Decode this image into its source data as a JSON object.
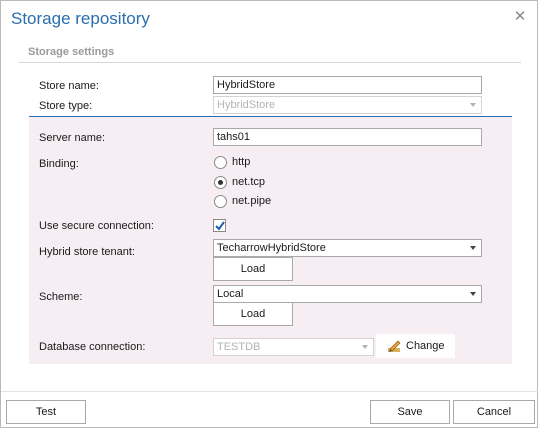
{
  "dialog": {
    "title": "Storage repository",
    "close_glyph": "✕"
  },
  "section": {
    "title": "Storage settings"
  },
  "fields": {
    "store_name_label": "Store name:",
    "store_name_value": "HybridStore",
    "store_type_label": "Store type:",
    "store_type_value": "HybridStore",
    "server_name_label": "Server name:",
    "server_name_value": "tahs01",
    "binding_label": "Binding:",
    "binding_options": [
      "http",
      "net.tcp",
      "net.pipe"
    ],
    "binding_selected": "net.tcp",
    "secure_label": "Use secure connection:",
    "secure_checked": true,
    "tenant_label": "Hybrid store tenant:",
    "tenant_value": "TecharrowHybridStore",
    "tenant_load": "Load",
    "scheme_label": "Scheme:",
    "scheme_value": "Local",
    "scheme_load": "Load",
    "db_label": "Database connection:",
    "db_value": "TESTDB",
    "db_change": "Change"
  },
  "footer": {
    "test": "Test",
    "save": "Save",
    "cancel": "Cancel"
  },
  "colors": {
    "accent": "#2a6fad",
    "section_bg": "#f6eef3"
  }
}
